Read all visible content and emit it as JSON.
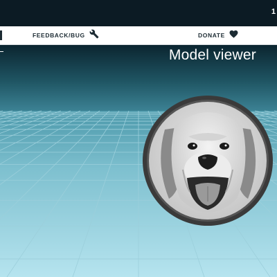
{
  "topbar": {
    "corner_text": "1"
  },
  "nav": {
    "feedback_label": "FEEDBACK/BUG",
    "feedback_icon": "wrench-icon",
    "donate_label": "DONATE",
    "donate_icon": "heart-icon"
  },
  "viewer": {
    "title": "Model viewer",
    "portrait_subject": "dog-portrait"
  },
  "colors": {
    "topbar": "#0c1b24",
    "sky_top": "#0b2530",
    "sky_horizon": "#3c8294",
    "floor_near": "#aee0ec",
    "grid_line": "#8fc6d3",
    "frame": "#3a3a3a"
  }
}
